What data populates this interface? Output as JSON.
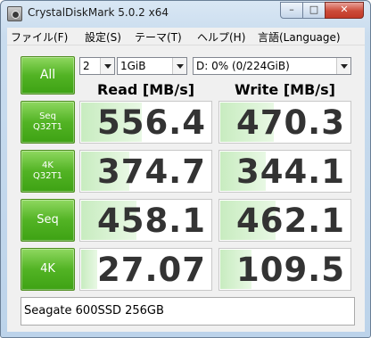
{
  "window": {
    "title": "CrystalDiskMark 5.0.2 x64",
    "buttons": {
      "minimize": "–",
      "maximize": "□",
      "close": "✕"
    }
  },
  "menu": [
    "ファイル(F)",
    "設定(S)",
    "テーマ(T)",
    "ヘルプ(H)",
    "言語(Language)"
  ],
  "controls": {
    "all_label": "All",
    "count": "2",
    "size": "1GiB",
    "drive": "D: 0% (0/224GiB)"
  },
  "headers": {
    "read": "Read [MB/s]",
    "write": "Write [MB/s]"
  },
  "tests": [
    {
      "label1": "Seq",
      "label2": "Q32T1",
      "read": "556.4",
      "write": "470.3",
      "read_fill": 0.46,
      "write_fill": 0.41
    },
    {
      "label1": "4K",
      "label2": "Q32T1",
      "read": "374.7",
      "write": "344.1",
      "read_fill": 0.37,
      "write_fill": 0.35
    },
    {
      "label1": "Seq",
      "label2": "",
      "read": "458.1",
      "write": "462.1",
      "read_fill": 0.42,
      "write_fill": 0.42
    },
    {
      "label1": "4K",
      "label2": "",
      "read": "27.07",
      "write": "109.5",
      "read_fill": 0.12,
      "write_fill": 0.24
    }
  ],
  "comment": "Seagate 600SSD 256GB",
  "colors": {
    "accent_green": "#52b324",
    "bar_fill": "#c8ecc0"
  }
}
